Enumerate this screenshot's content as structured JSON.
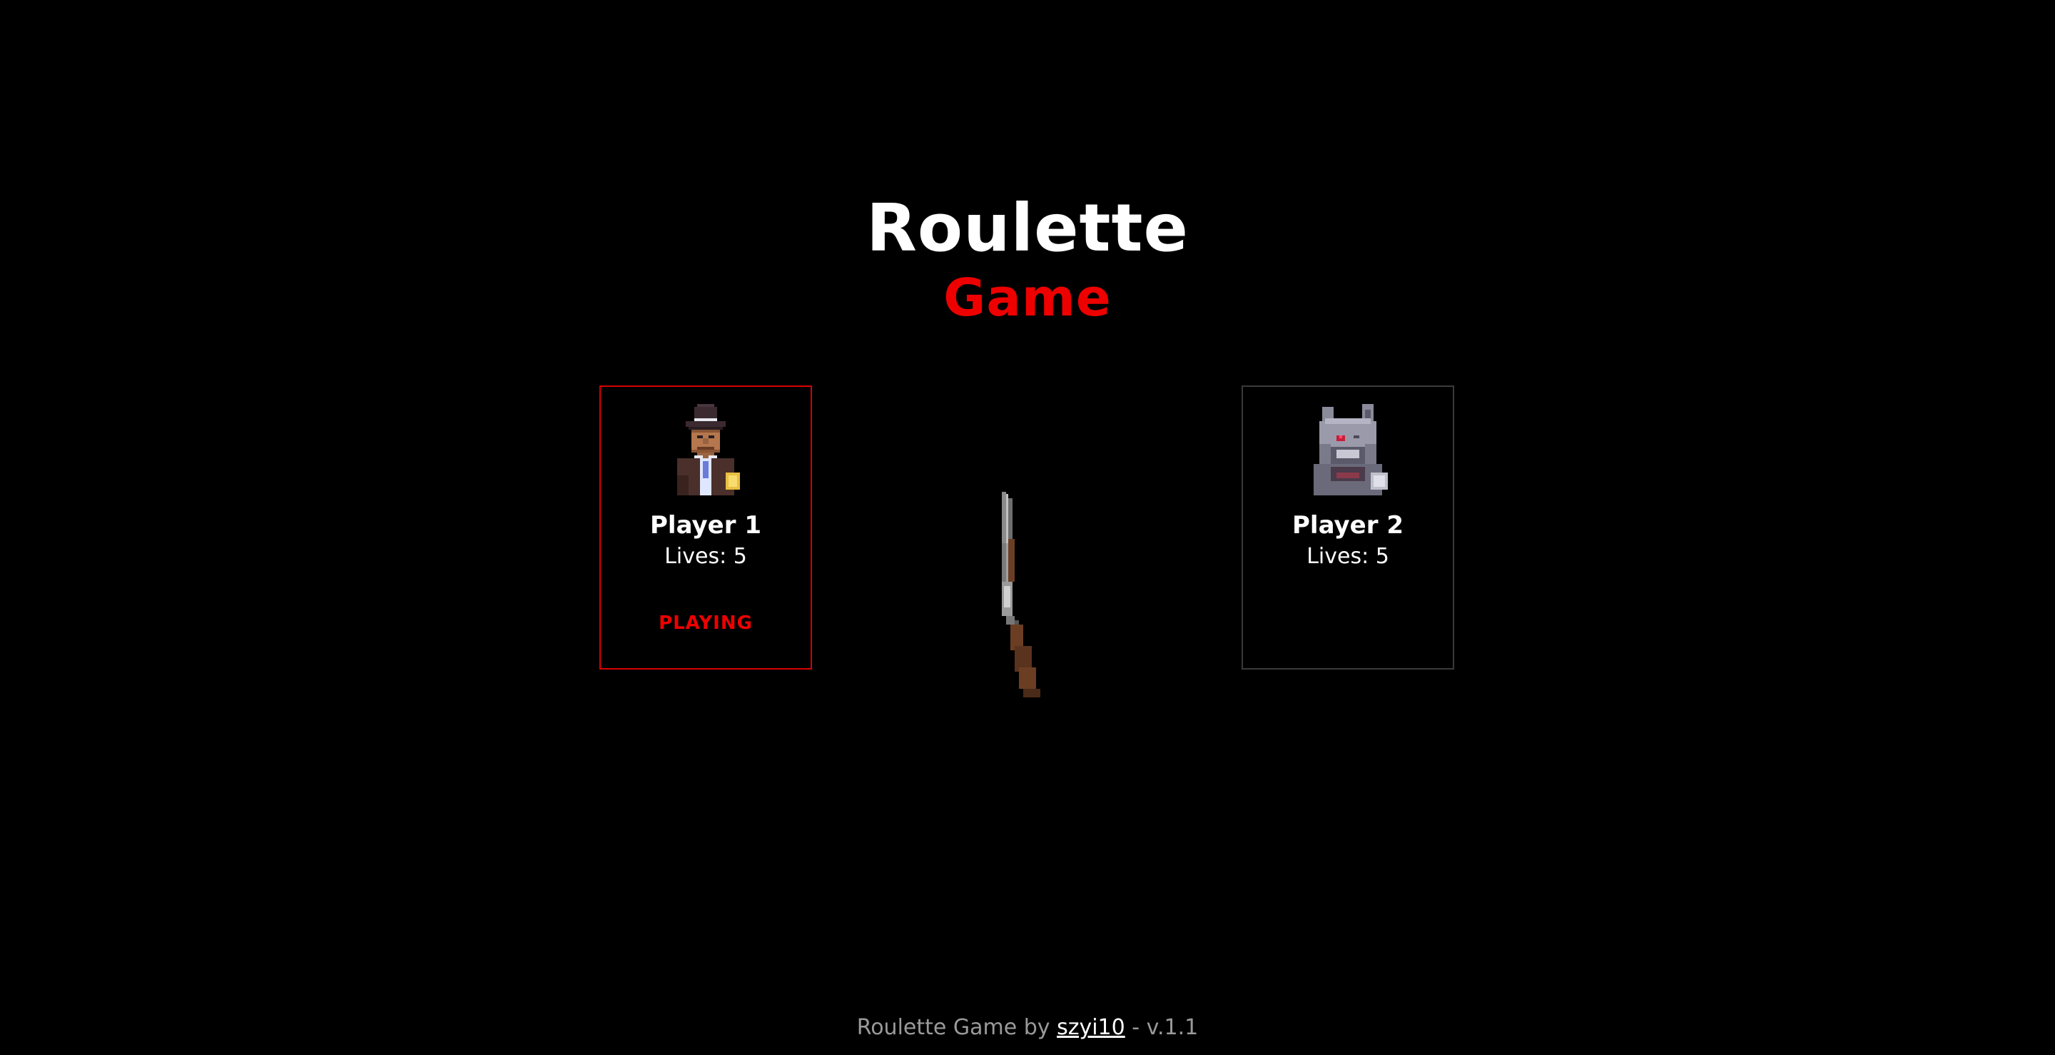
{
  "header": {
    "title": "Roulette",
    "subtitle": "Game"
  },
  "players": [
    {
      "name": "Player 1",
      "lives_text": "Lives: 5",
      "lives": 5,
      "status": "PLAYING",
      "active": true,
      "avatar_icon": "gangster-fedora-avatar-icon"
    },
    {
      "name": "Player 2",
      "lives_text": "Lives: 5",
      "lives": 5,
      "status": "",
      "active": false,
      "avatar_icon": "robot-wolf-avatar-icon"
    }
  ],
  "center": {
    "weapon_icon": "shotgun-icon"
  },
  "footer": {
    "prefix": "Roulette Game by ",
    "author": "szyi10",
    "suffix": " - v.1.1"
  },
  "colors": {
    "background": "#000000",
    "accent_red": "#ee0000",
    "active_border": "#d80000",
    "inactive_border": "#3a3a3a",
    "footer_text": "#9a9a9a"
  }
}
